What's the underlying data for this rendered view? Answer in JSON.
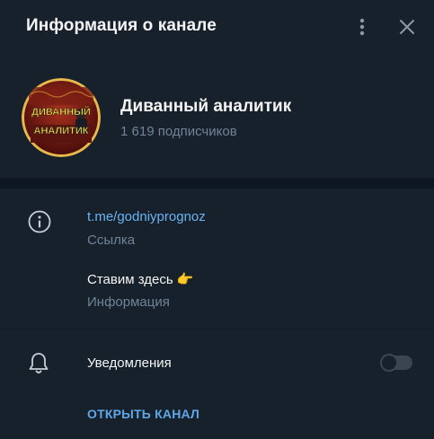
{
  "header": {
    "title": "Информация о канале",
    "more_icon": "more-vertical-icon",
    "close_icon": "close-icon"
  },
  "channel": {
    "name": "Диванный аналитик",
    "subscribers": "1 619 подписчиков",
    "avatar_text_top": "ДИВАННЫЙ",
    "avatar_text_bottom": "АНАЛИТИК"
  },
  "info": {
    "link": "t.me/godniyprognoz",
    "link_caption": "Ссылка",
    "description": "Ставим здесь 👉",
    "description_caption": "Информация"
  },
  "notifications": {
    "label": "Уведомления",
    "enabled": false
  },
  "actions": {
    "open_channel": "ОТКРЫТЬ КАНАЛ"
  },
  "colors": {
    "background": "#17212b",
    "divider": "#0e1621",
    "link": "#6ab3f3",
    "secondary_text": "#708499",
    "accent": "#5fa7e8"
  }
}
